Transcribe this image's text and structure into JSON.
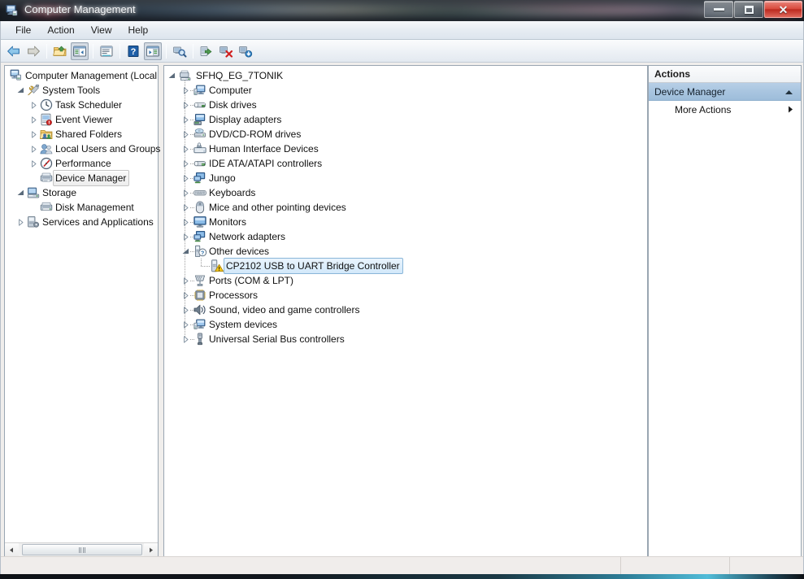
{
  "window": {
    "title": "Computer Management",
    "icon": "computer-management-icon",
    "controls": {
      "minimize": "Minimize",
      "maximize": "Maximize",
      "close": "Close"
    }
  },
  "menubar": {
    "items": [
      {
        "label": "File",
        "name": "menu-file"
      },
      {
        "label": "Action",
        "name": "menu-action"
      },
      {
        "label": "View",
        "name": "menu-view"
      },
      {
        "label": "Help",
        "name": "menu-help"
      }
    ]
  },
  "toolbar": {
    "buttons": [
      {
        "name": "back-button",
        "icon": "back-arrow-icon",
        "pressed": false
      },
      {
        "name": "forward-button",
        "icon": "forward-arrow-icon",
        "pressed": false
      },
      {
        "sep": true
      },
      {
        "name": "up-one-level-button",
        "icon": "folder-up-icon",
        "pressed": false
      },
      {
        "name": "show-hide-console-tree-button",
        "icon": "console-tree-icon",
        "pressed": true
      },
      {
        "sep": true
      },
      {
        "name": "properties-button",
        "icon": "properties-icon",
        "pressed": false
      },
      {
        "sep": true
      },
      {
        "name": "help-button",
        "icon": "help-question-icon",
        "pressed": false
      },
      {
        "name": "show-hide-action-pane-button",
        "icon": "action-pane-icon",
        "pressed": true
      },
      {
        "sep": true
      },
      {
        "name": "scan-for-hardware-changes-button",
        "icon": "scan-hardware-icon",
        "pressed": false
      },
      {
        "sep": true
      },
      {
        "name": "update-driver-button",
        "icon": "update-driver-icon",
        "pressed": false
      },
      {
        "name": "uninstall-device-button",
        "icon": "uninstall-device-icon",
        "pressed": false
      },
      {
        "name": "disable-device-button",
        "icon": "disable-device-icon",
        "pressed": false
      }
    ]
  },
  "console_tree": {
    "items": [
      {
        "label": "Computer Management (Local",
        "depth": 0,
        "twisty": "none",
        "icon": "computer-management-icon",
        "selected": false
      },
      {
        "label": "System Tools",
        "depth": 1,
        "twisty": "expanded",
        "icon": "system-tools-icon",
        "selected": false
      },
      {
        "label": "Task Scheduler",
        "depth": 2,
        "twisty": "collapsed",
        "icon": "clock-icon",
        "selected": false
      },
      {
        "label": "Event Viewer",
        "depth": 2,
        "twisty": "collapsed",
        "icon": "event-viewer-icon",
        "selected": false
      },
      {
        "label": "Shared Folders",
        "depth": 2,
        "twisty": "collapsed",
        "icon": "shared-folders-icon",
        "selected": false
      },
      {
        "label": "Local Users and Groups",
        "depth": 2,
        "twisty": "collapsed",
        "icon": "users-group-icon",
        "selected": false
      },
      {
        "label": "Performance",
        "depth": 2,
        "twisty": "collapsed",
        "icon": "performance-gauge-icon",
        "selected": false
      },
      {
        "label": "Device Manager",
        "depth": 2,
        "twisty": "none",
        "icon": "device-manager-icon",
        "selected": true
      },
      {
        "label": "Storage",
        "depth": 1,
        "twisty": "expanded",
        "icon": "storage-icon",
        "selected": false
      },
      {
        "label": "Disk Management",
        "depth": 2,
        "twisty": "none",
        "icon": "disk-management-icon",
        "selected": false
      },
      {
        "label": "Services and Applications",
        "depth": 1,
        "twisty": "collapsed",
        "icon": "services-apps-icon",
        "selected": false
      }
    ]
  },
  "device_tree": {
    "root": {
      "label": "SFHQ_EG_7TONIK",
      "twisty": "expanded",
      "icon": "computer-root-icon"
    },
    "items": [
      {
        "label": "Computer",
        "twisty": "collapsed",
        "icon": "computer-icon",
        "selected": false,
        "depth": 1
      },
      {
        "label": "Disk drives",
        "twisty": "collapsed",
        "icon": "disk-drive-icon",
        "selected": false,
        "depth": 1
      },
      {
        "label": "Display adapters",
        "twisty": "collapsed",
        "icon": "display-adapter-icon",
        "selected": false,
        "depth": 1
      },
      {
        "label": "DVD/CD-ROM drives",
        "twisty": "collapsed",
        "icon": "dvd-drive-icon",
        "selected": false,
        "depth": 1
      },
      {
        "label": "Human Interface Devices",
        "twisty": "collapsed",
        "icon": "hid-icon",
        "selected": false,
        "depth": 1
      },
      {
        "label": "IDE ATA/ATAPI controllers",
        "twisty": "collapsed",
        "icon": "ide-controller-icon",
        "selected": false,
        "depth": 1
      },
      {
        "label": "Jungo",
        "twisty": "collapsed",
        "icon": "jungo-icon",
        "selected": false,
        "depth": 1
      },
      {
        "label": "Keyboards",
        "twisty": "collapsed",
        "icon": "keyboard-icon",
        "selected": false,
        "depth": 1
      },
      {
        "label": "Mice and other pointing devices",
        "twisty": "collapsed",
        "icon": "mouse-icon",
        "selected": false,
        "depth": 1
      },
      {
        "label": "Monitors",
        "twisty": "collapsed",
        "icon": "monitor-icon",
        "selected": false,
        "depth": 1
      },
      {
        "label": "Network adapters",
        "twisty": "collapsed",
        "icon": "network-adapter-icon",
        "selected": false,
        "depth": 1
      },
      {
        "label": "Other devices",
        "twisty": "expanded",
        "icon": "other-devices-icon",
        "selected": false,
        "depth": 1
      },
      {
        "label": "CP2102 USB to UART Bridge Controller",
        "twisty": "none",
        "icon": "unknown-device-warning-icon",
        "selected": true,
        "depth": 2
      },
      {
        "label": "Ports (COM & LPT)",
        "twisty": "collapsed",
        "icon": "ports-icon",
        "selected": false,
        "depth": 1
      },
      {
        "label": "Processors",
        "twisty": "collapsed",
        "icon": "processor-icon",
        "selected": false,
        "depth": 1
      },
      {
        "label": "Sound, video and game controllers",
        "twisty": "collapsed",
        "icon": "sound-icon",
        "selected": false,
        "depth": 1
      },
      {
        "label": "System devices",
        "twisty": "collapsed",
        "icon": "system-device-icon",
        "selected": false,
        "depth": 1
      },
      {
        "label": "Universal Serial Bus controllers",
        "twisty": "collapsed",
        "icon": "usb-icon",
        "selected": false,
        "depth": 1
      }
    ]
  },
  "actions_pane": {
    "header": "Actions",
    "group": {
      "label": "Device Manager",
      "collapse_icon": "chevron-up-icon"
    },
    "items": [
      {
        "label": "More Actions",
        "submenu_icon": "triangle-right-icon"
      }
    ]
  },
  "statusbar": {
    "cells": [
      "",
      "",
      ""
    ]
  },
  "colors": {
    "selection_blue": "#d2e8fa",
    "actions_group_blue": "#a9c5e0",
    "warning_yellow": "#ffcc00",
    "close_button_red": "#d94b3e"
  }
}
